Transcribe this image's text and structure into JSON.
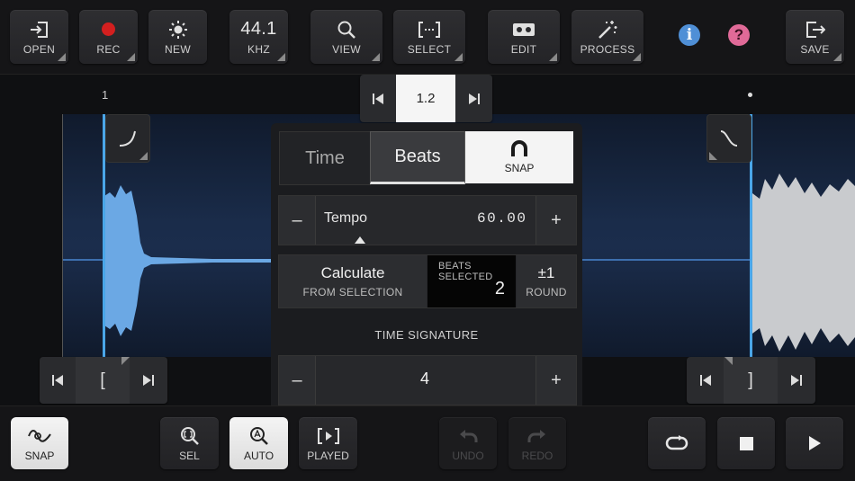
{
  "toolbar": {
    "open": "OPEN",
    "rec": "REC",
    "new": "NEW",
    "sample_rate_value": "44.1",
    "sample_rate_unit": "KHZ",
    "view": "VIEW",
    "select": "SELECT",
    "edit": "EDIT",
    "process": "PROCESS",
    "save": "SAVE",
    "info_glyph": "i",
    "help_glyph": "?"
  },
  "colors": {
    "accent_blue": "#4aa6e8",
    "rec_red": "#d31f1f",
    "info_blue": "#4f8fd6",
    "help_pink": "#e06a98"
  },
  "timeline": {
    "start_label": "1",
    "position_value": "1.2"
  },
  "panel": {
    "tab_time": "Time",
    "tab_beats": "Beats",
    "snap_label": "SNAP",
    "tempo_label": "Tempo",
    "tempo_value": "60.00",
    "minus": "–",
    "plus": "+",
    "calculate_title": "Calculate",
    "calculate_sub": "FROM SELECTION",
    "beats_selected_label": "BEATS SELECTED",
    "beats_selected_value": "2",
    "round_value": "±1",
    "round_label": "ROUND",
    "time_signature_label": "TIME SIGNATURE",
    "time_signature_value": "4"
  },
  "selection_nav": {
    "left_bracket": "[",
    "right_bracket": "]"
  },
  "bottombar": {
    "snap": "SNAP",
    "sel": "SEL",
    "auto": "AUTO",
    "played": "PLAYED",
    "undo": "UNDO",
    "redo": "REDO"
  }
}
